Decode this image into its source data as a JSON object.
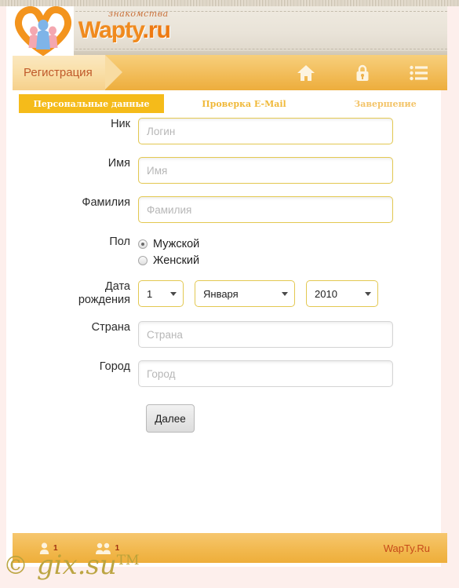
{
  "site": {
    "logo_tagline": "знакомства",
    "logo_name": "Wapty",
    "logo_tld": ".ru"
  },
  "navbar": {
    "section_label": "Регистрация",
    "icons": [
      {
        "name": "home-icon",
        "title": "Главная"
      },
      {
        "name": "lock-icon",
        "title": "Вход"
      },
      {
        "name": "list-icon",
        "title": "Меню"
      }
    ]
  },
  "steps": [
    {
      "label": "Персональные данные",
      "active": true
    },
    {
      "label": "Проверка E-Mail",
      "active": false
    },
    {
      "label": "Завершение",
      "active": false
    }
  ],
  "form": {
    "nick": {
      "label": "Ник",
      "placeholder": "Логин",
      "value": ""
    },
    "first_name": {
      "label": "Имя",
      "placeholder": "Имя",
      "value": ""
    },
    "last_name": {
      "label": "Фамилия",
      "placeholder": "Фамилия",
      "value": ""
    },
    "gender": {
      "label": "Пол",
      "options": [
        {
          "label": "Мужской",
          "selected": true
        },
        {
          "label": "Женский",
          "selected": false
        }
      ]
    },
    "birth_date": {
      "label_line1": "Дата",
      "label_line2": "рождения",
      "day": "1",
      "month": "Января",
      "year": "2010"
    },
    "country": {
      "label": "Страна",
      "placeholder": "Страна",
      "value": ""
    },
    "city": {
      "label": "Город",
      "placeholder": "Город",
      "value": ""
    },
    "submit_label": "Далее"
  },
  "footer": {
    "users_online": "1",
    "guests_online": "1",
    "brand": "WapTy.Ru"
  },
  "watermark": {
    "copyright": "©",
    "text": "gix.su",
    "tm": "TM"
  },
  "colors": {
    "accent": "#f5bb1a",
    "navbar": "#f3c060",
    "logo_orange": "#f08a1e",
    "field_border": "#e3c851",
    "page_bg": "#fdefec"
  }
}
